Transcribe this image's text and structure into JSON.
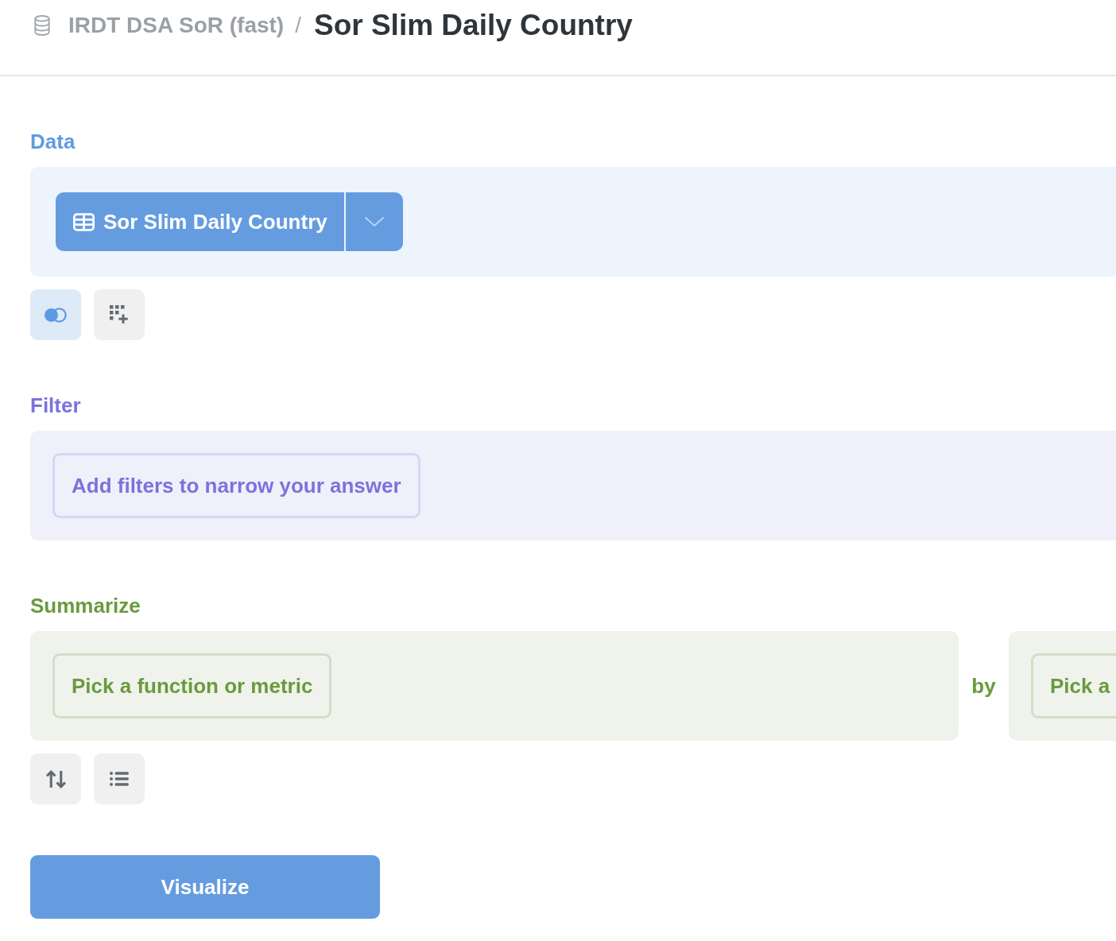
{
  "breadcrumb": {
    "database": "IRDT DSA SoR (fast)",
    "separator": "/",
    "title": "Sor Slim Daily Country"
  },
  "data": {
    "label": "Data",
    "table": "Sor Slim Daily Country",
    "actions": [
      {
        "kind": "join"
      },
      {
        "kind": "custom-column"
      }
    ]
  },
  "filter": {
    "label": "Filter",
    "button": "Add filters to narrow your answer"
  },
  "summarize": {
    "label": "Summarize",
    "metric_button": "Pick a function or metric",
    "by": "by",
    "group_button": "Pick a",
    "actions": [
      {
        "kind": "sort"
      },
      {
        "kind": "limit"
      }
    ]
  },
  "visualize_button": "Visualize"
}
